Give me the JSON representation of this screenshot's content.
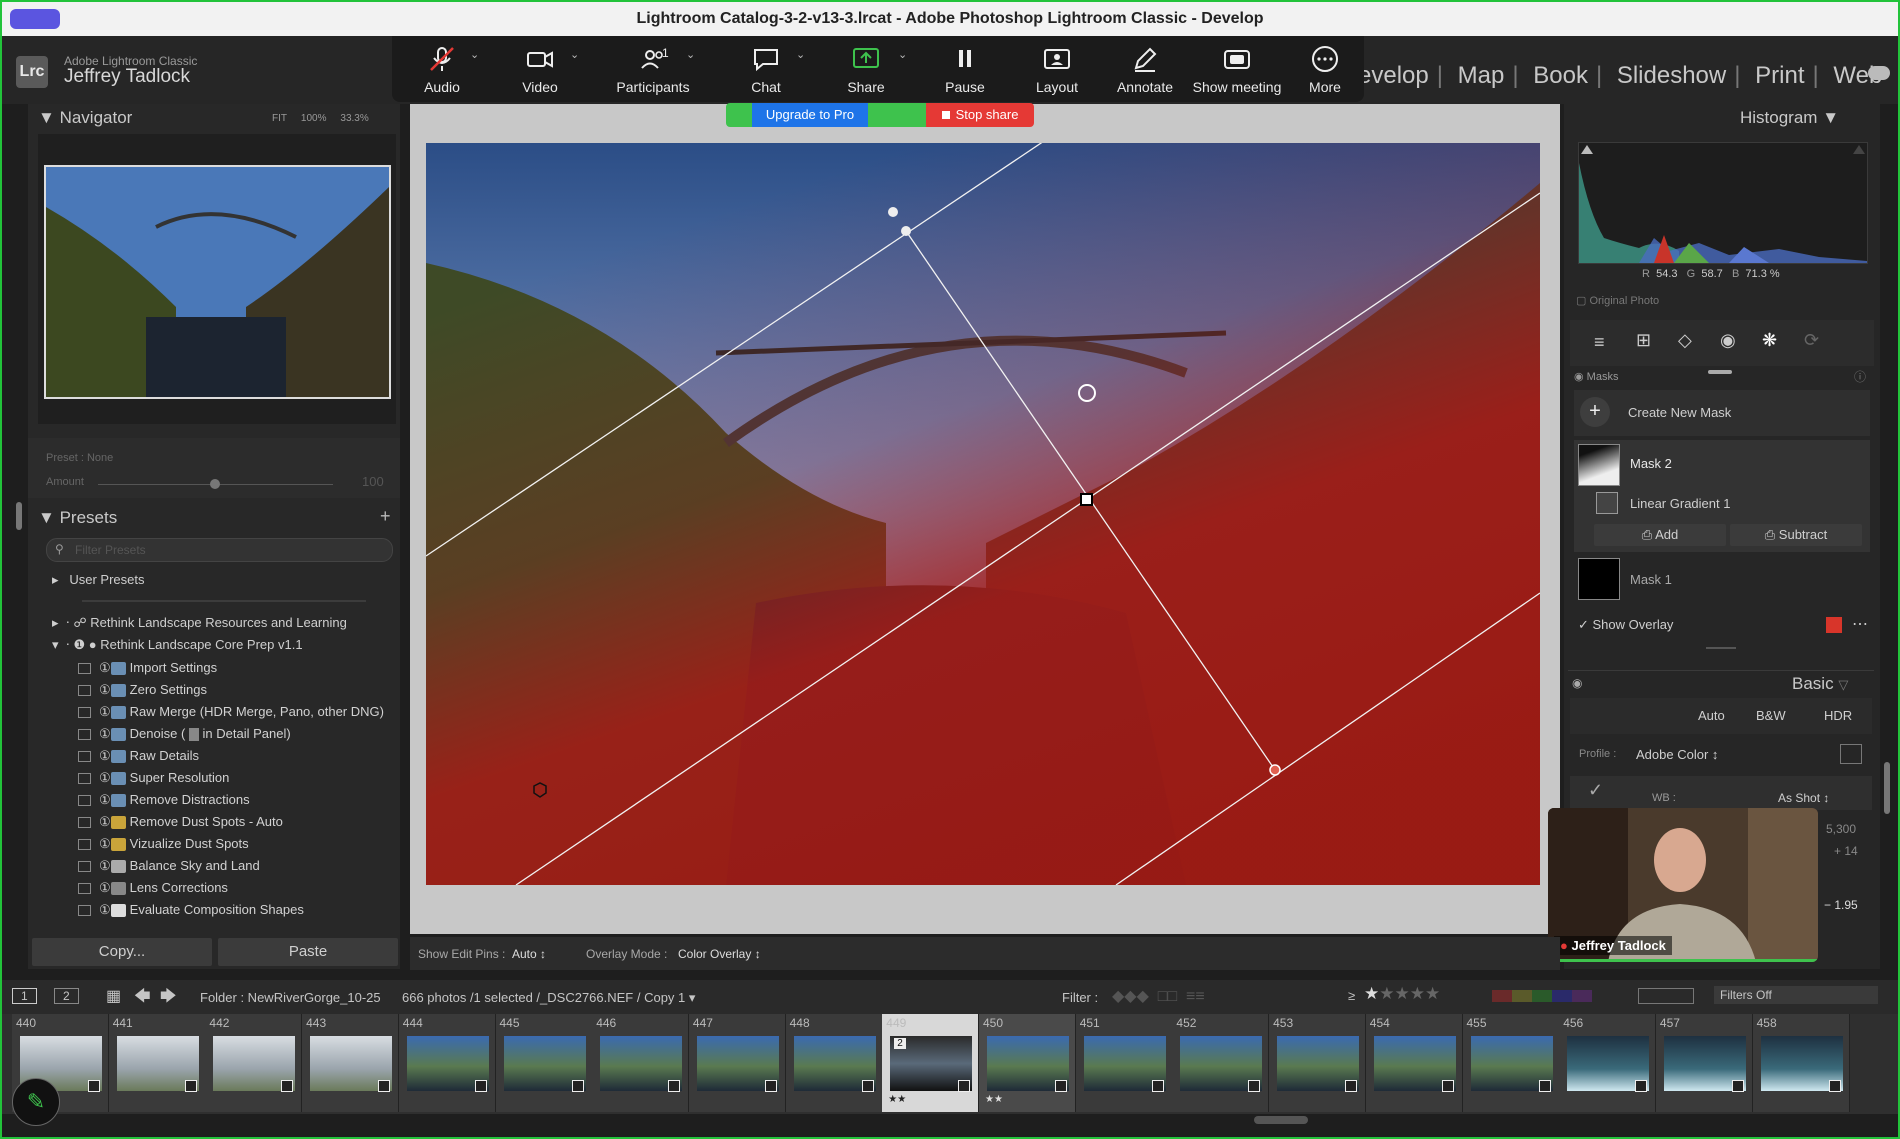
{
  "window": {
    "title": "Lightroom Catalog-3-2-v13-3.lrcat - Adobe Photoshop Lightroom Classic - Develop"
  },
  "brand": {
    "logo": "Lrc",
    "product": "Adobe Lightroom Classic",
    "user": "Jeffrey Tadlock"
  },
  "modules": [
    "evelop",
    "Map",
    "Book",
    "Slideshow",
    "Print",
    "Web"
  ],
  "zoom_toolbar": {
    "items": [
      {
        "label": "Audio",
        "icon": "mic-muted-icon"
      },
      {
        "label": "Video",
        "icon": "video-camera-icon"
      },
      {
        "label": "Participants",
        "icon": "participants-icon",
        "count": "1"
      },
      {
        "label": "Chat",
        "icon": "chat-bubble-icon"
      },
      {
        "label": "Share",
        "icon": "share-screen-icon"
      },
      {
        "label": "Pause",
        "icon": "pause-icon"
      },
      {
        "label": "Layout",
        "icon": "layout-icon"
      },
      {
        "label": "Annotate",
        "icon": "pencil-icon"
      },
      {
        "label": "Show meeting",
        "icon": "show-meeting-icon"
      },
      {
        "label": "More",
        "icon": "more-dots-icon"
      }
    ],
    "upgrade_label": "Upgrade to Pro",
    "stop_share_label": "Stop share"
  },
  "navigator": {
    "title": "Navigator",
    "zoom_options": [
      "FIT",
      "100%",
      "33.3%"
    ]
  },
  "preset_amount": {
    "preset_label": "Preset : None",
    "amount_label": "Amount",
    "amount_value": "100"
  },
  "presets": {
    "title": "Presets",
    "add_symbol": "+",
    "filter_placeholder": "Filter Presets",
    "groups": [
      "User Presets",
      "Rethink Landscape Resources and Learning",
      "Rethink Landscape Core Prep v1.1"
    ],
    "items": [
      "Import Settings",
      "Zero Settings",
      "Raw Merge (HDR Merge, Pano, other DNG)",
      "Denoise (",
      "in Detail Panel)",
      "Raw Details",
      "Super Resolution",
      "Remove Distractions",
      "Remove Dust Spots - Auto",
      "Vizualize Dust Spots",
      "Balance Sky and Land",
      "Lens Corrections",
      "Evaluate Composition Shapes"
    ]
  },
  "left_buttons": {
    "copy": "Copy...",
    "paste": "Paste"
  },
  "histogram": {
    "title": "Histogram",
    "r_label": "R",
    "r_value": "54.3",
    "g_label": "G",
    "g_value": "58.7",
    "b_label": "B",
    "b_value": "71.3",
    "percent": "%",
    "original_photo": "Original Photo"
  },
  "masks": {
    "title": "Masks",
    "create_new": "Create New Mask",
    "mask2": "Mask 2",
    "linear_gradient": "Linear Gradient 1",
    "add": "Add",
    "subtract": "Subtract",
    "mask1": "Mask 1",
    "show_overlay": "Show Overlay",
    "overlay_color": "#d8352a"
  },
  "basic": {
    "title": "Basic",
    "auto": "Auto",
    "bw": "B&W",
    "hdr": "HDR",
    "profile_label": "Profile :",
    "profile_value": "Adobe Color",
    "wb_label": "WB :",
    "wb_value": "As Shot",
    "temp_value": "5,300",
    "tint_value": "+ 14",
    "exposure_value": "− 1.95"
  },
  "webcam": {
    "name": "Jeffrey Tadlock"
  },
  "toolbar": {
    "edit_pins_label": "Show Edit Pins :",
    "edit_pins_value": "Auto",
    "overlay_mode_label": "Overlay Mode :",
    "overlay_mode_value": "Color Overlay"
  },
  "filmbar": {
    "view1": "1",
    "view2": "2",
    "folder": "Folder : NewRiverGorge_10-25",
    "count": "666 photos /1 selected /_DSC2766.NEF / Copy 1",
    "filter_label": "Filter :",
    "filters_off": "Filters Off",
    "gte": "≥"
  },
  "filmstrip": {
    "numbers": [
      "440",
      "441",
      "442",
      "443",
      "444",
      "445",
      "446",
      "447",
      "448",
      "449",
      "450",
      "451",
      "452",
      "453",
      "454",
      "455",
      "456",
      "457",
      "458"
    ],
    "selected_index": 9,
    "stack_badge": "2",
    "stars_449": "★★",
    "stars_450": "★★"
  }
}
